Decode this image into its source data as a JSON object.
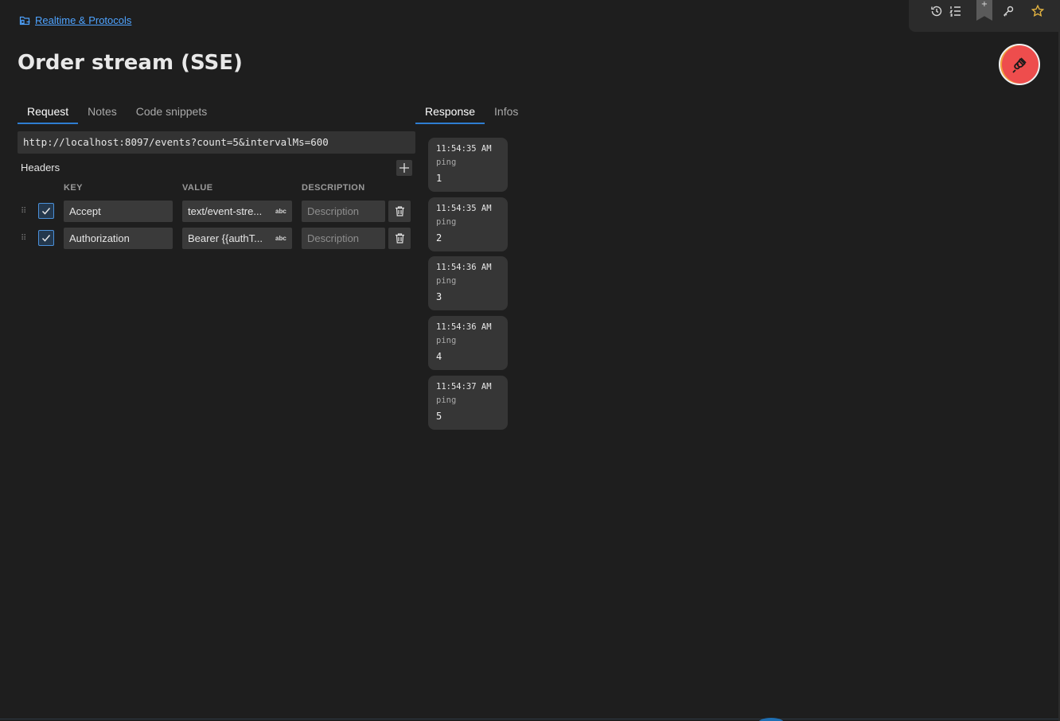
{
  "breadcrumb": {
    "icon": "folder-link-icon",
    "label": "Realtime & Protocols"
  },
  "page": {
    "title": "Order stream (SSE)"
  },
  "toolbar": {
    "icons": [
      "history-icon",
      "list-icon",
      "bookmark-icon",
      "key-icon",
      "star-icon"
    ],
    "bookmark_label": "+"
  },
  "status": {
    "icon": "plug-disconnected-icon",
    "color": "#ee4d4d"
  },
  "request_tabs": [
    {
      "label": "Request",
      "active": true
    },
    {
      "label": "Notes",
      "active": false
    },
    {
      "label": "Code snippets",
      "active": false
    }
  ],
  "response_tabs": [
    {
      "label": "Response",
      "active": true
    },
    {
      "label": "Infos",
      "active": false
    }
  ],
  "request": {
    "url": "http://localhost:8097/events?count=5&intervalMs=600",
    "headers_label": "Headers",
    "columns": {
      "key": "KEY",
      "value": "VALUE",
      "description": "DESCRIPTION"
    },
    "value_badge": "abc",
    "headers": [
      {
        "enabled": true,
        "key": "Accept",
        "value": "text/event-stre...",
        "description_placeholder": "Description"
      },
      {
        "enabled": true,
        "key": "Authorization",
        "value": "Bearer {{authT...",
        "description_placeholder": "Description"
      }
    ]
  },
  "response": {
    "messages": [
      {
        "time": "11:54:35 AM",
        "event": "ping",
        "data": "1"
      },
      {
        "time": "11:54:35 AM",
        "event": "ping",
        "data": "2"
      },
      {
        "time": "11:54:36 AM",
        "event": "ping",
        "data": "3"
      },
      {
        "time": "11:54:36 AM",
        "event": "ping",
        "data": "4"
      },
      {
        "time": "11:54:37 AM",
        "event": "ping",
        "data": "5"
      }
    ]
  },
  "colors": {
    "accent": "#2f7dd1",
    "link": "#4ea3ff",
    "background": "#1e1e1e"
  }
}
